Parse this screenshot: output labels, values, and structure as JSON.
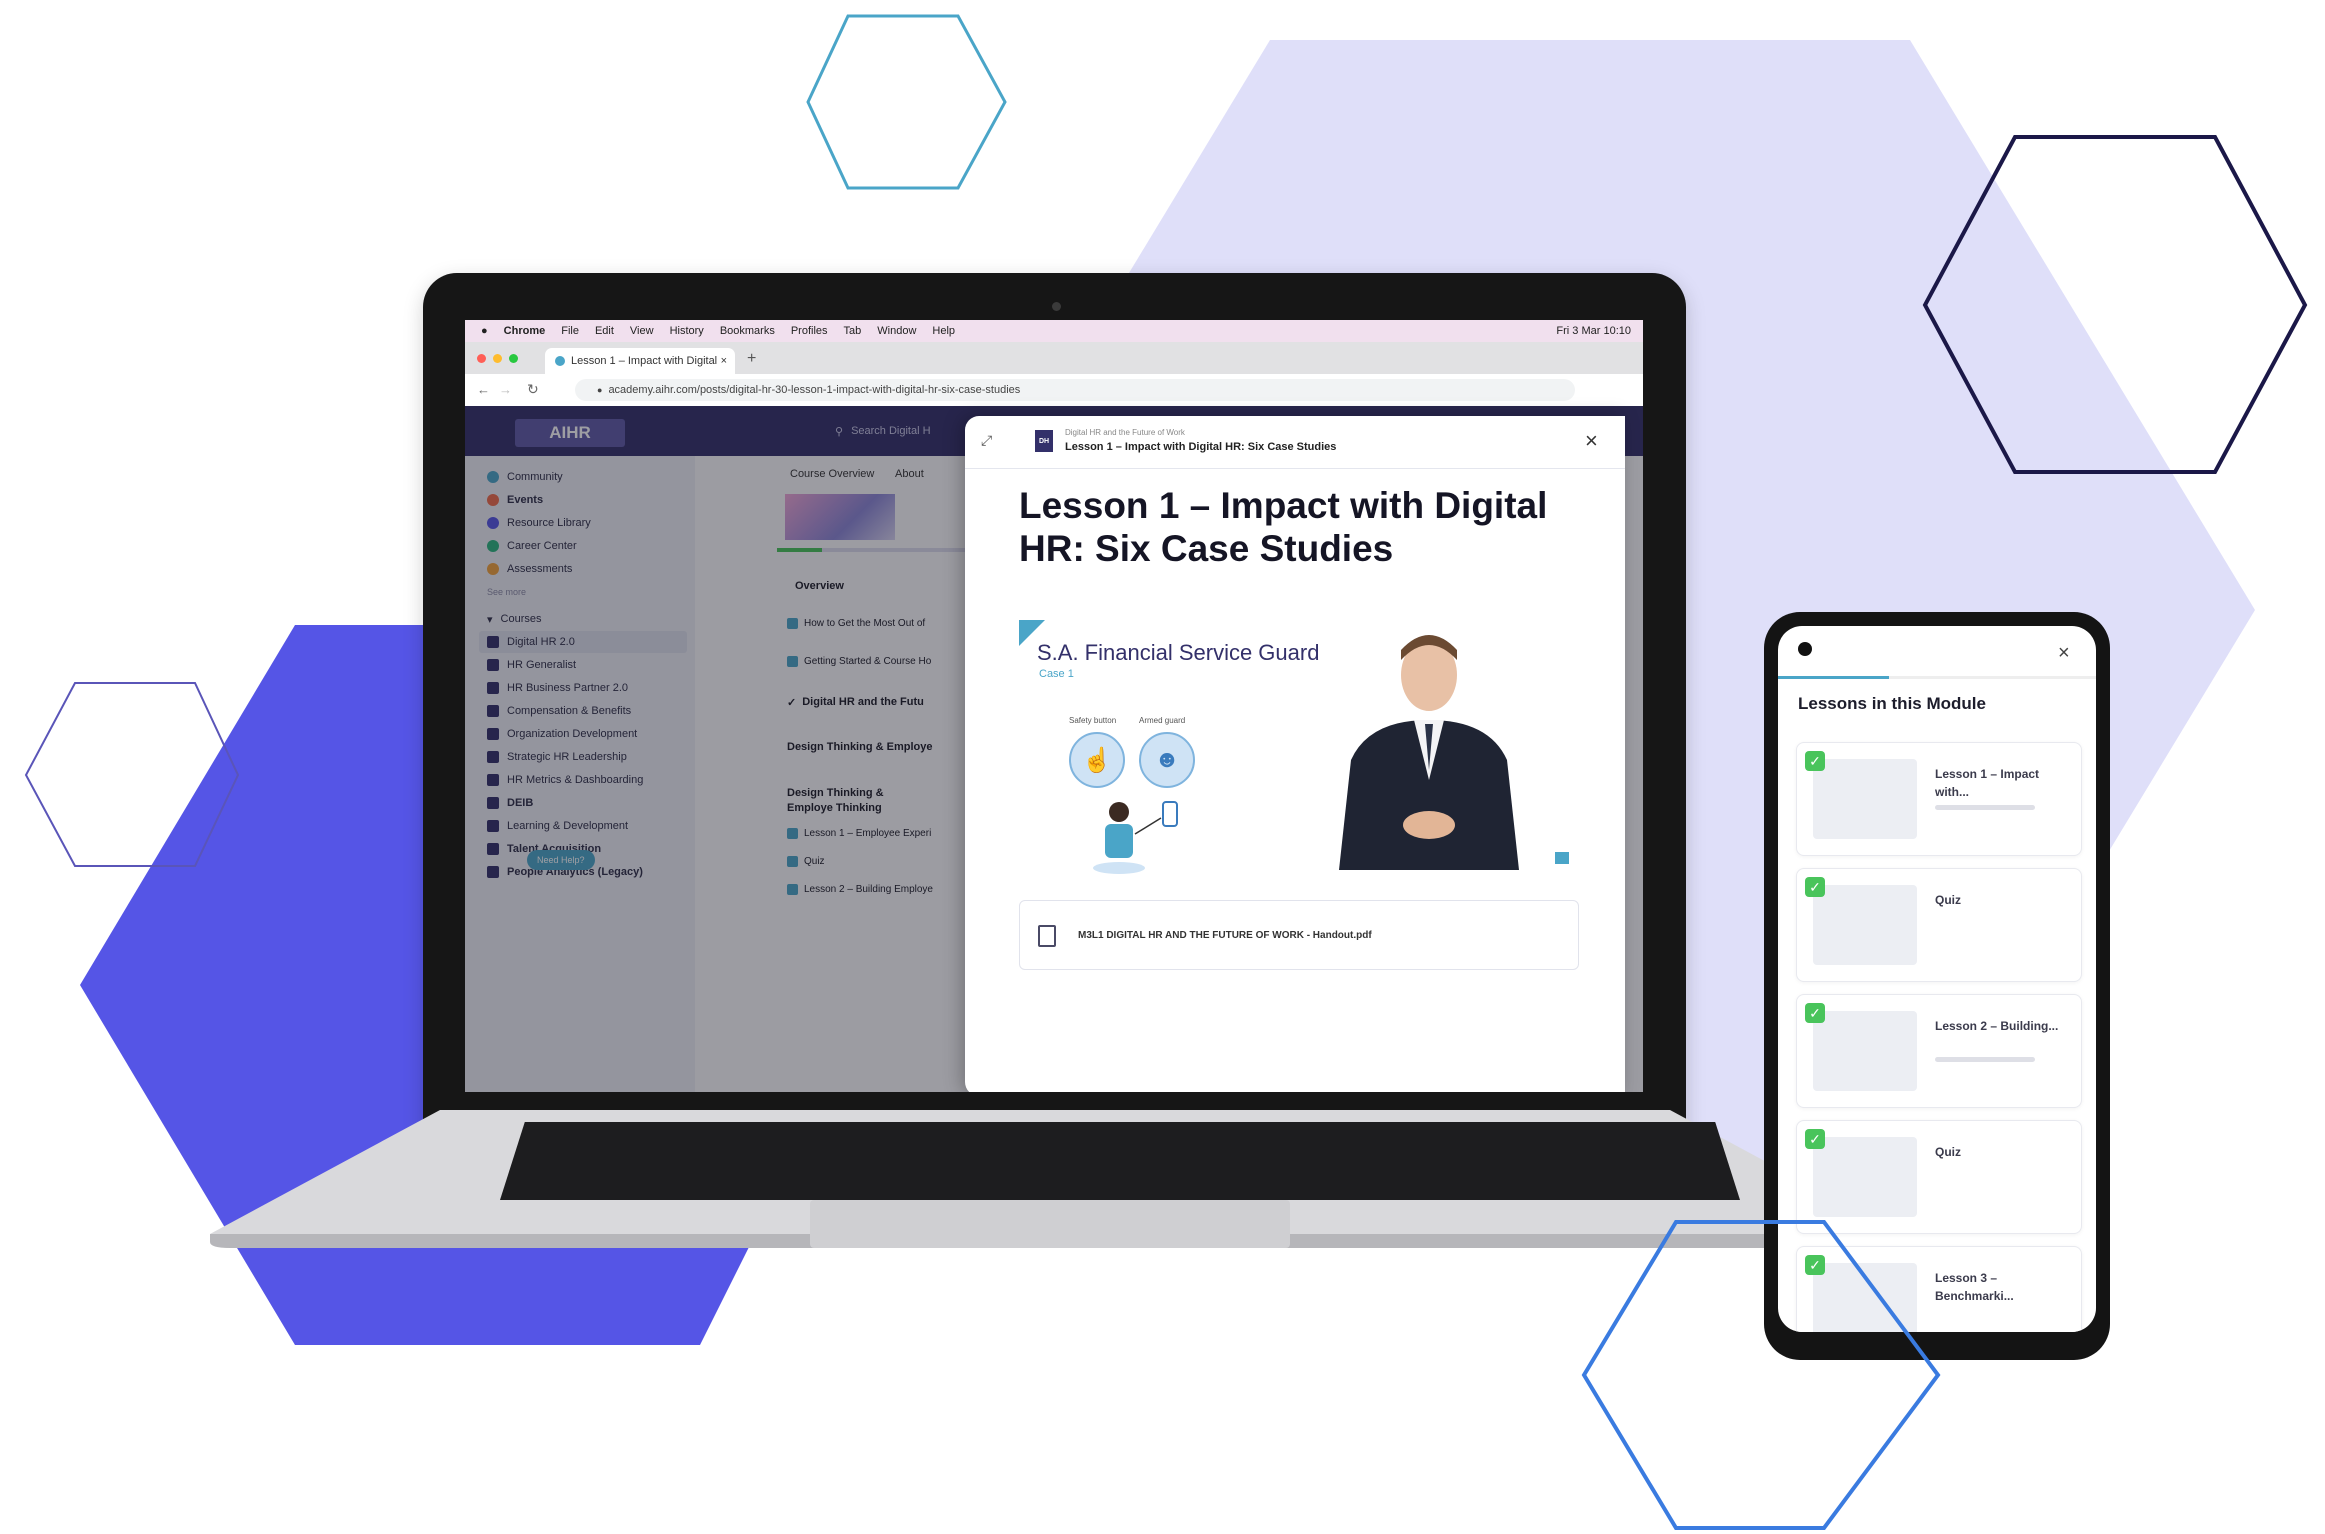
{
  "colors": {
    "indigo": "#5555e6",
    "lavender": "#dfdff9",
    "navy": "#1b1848",
    "teal": "#4aa5c8",
    "blue": "#3a7be0",
    "check_green": "#49c45b"
  },
  "mac_menu": [
    "Chrome",
    "File",
    "Edit",
    "View",
    "History",
    "Bookmarks",
    "Profiles",
    "Tab",
    "Window",
    "Help"
  ],
  "mac_clock": "Fri 3 Mar 10:10",
  "browser": {
    "tab_title": "Lesson 1 – Impact with Digital",
    "url": "academy.aihr.com/posts/digital-hr-30-lesson-1-impact-with-digital-hr-six-case-studies"
  },
  "app": {
    "logo": "AIHR",
    "search_placeholder": "Search Digital H",
    "tabs": [
      "Course Overview",
      "About"
    ],
    "help_button": "Need Help?"
  },
  "sidebar": [
    {
      "label": "Community",
      "color": "#4aa5c8"
    },
    {
      "label": "Events",
      "color": "#ef6b4a"
    },
    {
      "label": "Resource Library",
      "color": "#5555e6"
    },
    {
      "label": "Career Center",
      "color": "#2bb57f"
    },
    {
      "label": "Assessments",
      "color": "#f2a23b"
    },
    {
      "label": "See more",
      "color": ""
    },
    {
      "label": "Courses",
      "color": ""
    },
    {
      "label": "Digital HR 2.0",
      "color": "#33306a"
    },
    {
      "label": "HR Generalist",
      "color": "#33306a"
    },
    {
      "label": "HR Business Partner 2.0",
      "color": "#33306a"
    },
    {
      "label": "Compensation & Benefits",
      "color": "#33306a"
    },
    {
      "label": "Organization Development",
      "color": "#33306a"
    },
    {
      "label": "Strategic HR Leadership",
      "color": "#33306a"
    },
    {
      "label": "HR Metrics & Dashboarding",
      "color": "#33306a"
    },
    {
      "label": "DEIB",
      "color": "#33306a"
    },
    {
      "label": "Learning & Development",
      "color": "#33306a"
    },
    {
      "label": "Talent Acquisition",
      "color": "#33306a"
    },
    {
      "label": "People Analytics (Legacy)",
      "color": "#33306a"
    }
  ],
  "course_outline": [
    "Overview",
    "How to Get the Most Out of",
    "Getting Started & Course Ho",
    "Digital HR and the Futu",
    "Design Thinking & Employe",
    "Design Thinking & Employe Thinking",
    "Lesson 1 – Employee Experi",
    "Quiz",
    "Lesson 2 – Building Employe"
  ],
  "modal": {
    "breadcrumb": "Digital HR and the Future of Work",
    "header_title": "Lesson 1 – Impact with Digital HR: Six Case Studies",
    "lesson_title": "Lesson 1 – Impact with Digital HR: Six Case Studies",
    "case_title": "S.A. Financial Service Guard",
    "case_number": "Case 1",
    "case_labels": [
      "Safety button",
      "Armed guard"
    ],
    "handout": "M3L1 DIGITAL HR AND THE FUTURE OF WORK - Handout.pdf"
  },
  "phone": {
    "title": "Lessons in this Module",
    "lessons": [
      {
        "label": "Lesson 1 – Impact with...",
        "icon": "laptop-illustration"
      },
      {
        "label": "Quiz",
        "icon": "hourglass-illustration"
      },
      {
        "label": "Lesson 2 – Building...",
        "icon": "laptop-illustration"
      },
      {
        "label": "Quiz",
        "icon": "hourglass-illustration"
      },
      {
        "label": "Lesson 3 – Benchmarki...",
        "icon": "brain-illustration"
      }
    ]
  }
}
